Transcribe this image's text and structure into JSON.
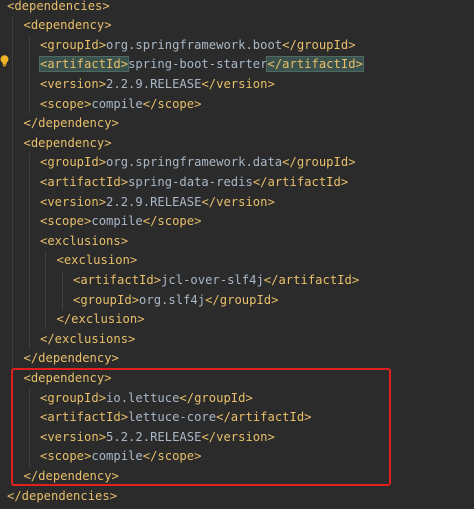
{
  "xml": {
    "lines": [
      {
        "indent": 0,
        "open": "<dependencies>",
        "text": "",
        "close": ""
      },
      {
        "indent": 1,
        "open": "<dependency>",
        "text": "",
        "close": ""
      },
      {
        "indent": 2,
        "open": "<groupId>",
        "text": "org.springframework.boot",
        "close": "</groupId>"
      },
      {
        "indent": 2,
        "open": "<artifactId>",
        "text": "spring-boot-starter",
        "close": "</artifactId>"
      },
      {
        "indent": 2,
        "open": "<version>",
        "text": "2.2.9.RELEASE",
        "close": "</version>"
      },
      {
        "indent": 2,
        "open": "<scope>",
        "text": "compile",
        "close": "</scope>"
      },
      {
        "indent": 1,
        "open": "</dependency>",
        "text": "",
        "close": ""
      },
      {
        "indent": 1,
        "open": "<dependency>",
        "text": "",
        "close": ""
      },
      {
        "indent": 2,
        "open": "<groupId>",
        "text": "org.springframework.data",
        "close": "</groupId>"
      },
      {
        "indent": 2,
        "open": "<artifactId>",
        "text": "spring-data-redis",
        "close": "</artifactId>"
      },
      {
        "indent": 2,
        "open": "<version>",
        "text": "2.2.9.RELEASE",
        "close": "</version>"
      },
      {
        "indent": 2,
        "open": "<scope>",
        "text": "compile",
        "close": "</scope>"
      },
      {
        "indent": 2,
        "open": "<exclusions>",
        "text": "",
        "close": ""
      },
      {
        "indent": 3,
        "open": "<exclusion>",
        "text": "",
        "close": ""
      },
      {
        "indent": 4,
        "open": "<artifactId>",
        "text": "jcl-over-slf4j",
        "close": "</artifactId>"
      },
      {
        "indent": 4,
        "open": "<groupId>",
        "text": "org.slf4j",
        "close": "</groupId>"
      },
      {
        "indent": 3,
        "open": "</exclusion>",
        "text": "",
        "close": ""
      },
      {
        "indent": 2,
        "open": "</exclusions>",
        "text": "",
        "close": ""
      },
      {
        "indent": 1,
        "open": "</dependency>",
        "text": "",
        "close": ""
      },
      {
        "indent": 1,
        "open": "<dependency>",
        "text": "",
        "close": ""
      },
      {
        "indent": 2,
        "open": "<groupId>",
        "text": "io.lettuce",
        "close": "</groupId>"
      },
      {
        "indent": 2,
        "open": "<artifactId>",
        "text": "lettuce-core",
        "close": "</artifactId>"
      },
      {
        "indent": 2,
        "open": "<version>",
        "text": "5.2.2.RELEASE",
        "close": "</version>"
      },
      {
        "indent": 2,
        "open": "<scope>",
        "text": "compile",
        "close": "</scope>"
      },
      {
        "indent": 1,
        "open": "</dependency>",
        "text": "",
        "close": ""
      },
      {
        "indent": 0,
        "open": "</dependencies>",
        "text": "",
        "close": ""
      }
    ]
  },
  "colors": {
    "background": "#2b2b2b",
    "tag": "#e8bf6a",
    "text": "#a9b7c6",
    "highlight_box": "#e0201e",
    "bulb": "#f0b429"
  },
  "icons": {
    "gutter": "lightbulb-icon"
  }
}
